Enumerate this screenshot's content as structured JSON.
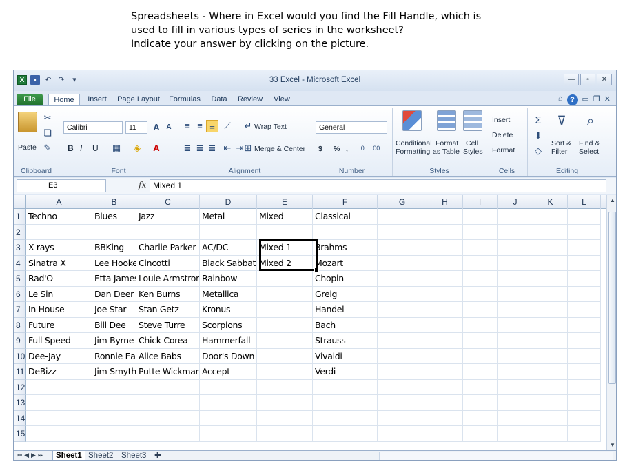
{
  "question": {
    "line1": "Spreadsheets - Where in Excel would you find the Fill Handle, which is",
    "line2": "used to fill in various types of series in the worksheet?",
    "line3": "Indicate your answer by clicking on the picture."
  },
  "window": {
    "title": "33 Excel - Microsoft Excel",
    "app_icon": "X",
    "controls": {
      "minimize": "—",
      "restore": "▫",
      "close": "✕"
    }
  },
  "ribbon_tabs": [
    "File",
    "Home",
    "Insert",
    "Page Layout",
    "Formulas",
    "Data",
    "Review",
    "View"
  ],
  "ribbon": {
    "clipboard": {
      "label": "Clipboard",
      "paste": "Paste"
    },
    "font": {
      "label": "Font",
      "name": "Calibri",
      "size": "11",
      "bold": "B",
      "italic": "I",
      "underline": "U"
    },
    "alignment": {
      "label": "Alignment",
      "wrap": "Wrap Text",
      "merge": "Merge & Center"
    },
    "number": {
      "label": "Number",
      "format": "General",
      "currency": "$",
      "percent": "%",
      "comma": ","
    },
    "styles": {
      "label": "Styles",
      "conditional": "Conditional",
      "conditional2": "Formatting",
      "format_table": "Format",
      "format_table2": "as Table",
      "cell_styles": "Cell",
      "cell_styles2": "Styles"
    },
    "cells": {
      "label": "Cells",
      "insert": "Insert",
      "delete": "Delete",
      "format": "Format"
    },
    "editing": {
      "label": "Editing",
      "sort": "Sort &",
      "sort2": "Filter",
      "find": "Find &",
      "find2": "Select"
    }
  },
  "formula_bar": {
    "name_box": "E3",
    "fx": "fx",
    "value": "Mixed 1"
  },
  "columns": [
    "A",
    "B",
    "C",
    "D",
    "E",
    "F",
    "G",
    "H",
    "I",
    "J",
    "K",
    "L"
  ],
  "rows": [
    [
      "Techno",
      "Blues",
      "Jazz",
      "Metal",
      "Mixed",
      "Classical"
    ],
    [
      "",
      "",
      "",
      "",
      "",
      ""
    ],
    [
      "X-rays",
      "BBKing",
      "Charlie Parker",
      "AC/DC",
      "Mixed 1",
      "Brahms"
    ],
    [
      "Sinatra X",
      "Lee Hooker",
      "Cincotti",
      "Black Sabbath",
      "Mixed 2",
      "Mozart"
    ],
    [
      "Rad'O",
      "Etta James",
      "Louie Armstrong",
      "Rainbow",
      "",
      "Chopin"
    ],
    [
      "Le Sin",
      "Dan Deer",
      "Ken Burns",
      "Metallica",
      "",
      "Greig"
    ],
    [
      "In House",
      "Joe Star",
      "Stan Getz",
      "Kronus",
      "",
      "Handel"
    ],
    [
      "Future",
      "Bill Dee",
      "Steve Turre",
      "Scorpions",
      "",
      "Bach"
    ],
    [
      "Full Speed",
      "Jim Byrne",
      "Chick Corea",
      "Hammerfall",
      "",
      "Strauss"
    ],
    [
      "Dee-Jay",
      "Ronnie Earl",
      "Alice Babs",
      "Door's Down",
      "",
      "Vivaldi"
    ],
    [
      "DeBizz",
      "Jim Smythe",
      "Putte Wickman",
      "Accept",
      "",
      "Verdi"
    ],
    [
      "",
      "",
      "",
      "",
      "",
      ""
    ],
    [
      "",
      "",
      "",
      "",
      "",
      ""
    ],
    [
      "",
      "",
      "",
      "",
      "",
      ""
    ],
    [
      "",
      "",
      "",
      "",
      "",
      ""
    ]
  ],
  "sheet_tabs": [
    "Sheet1",
    "Sheet2",
    "Sheet3"
  ]
}
